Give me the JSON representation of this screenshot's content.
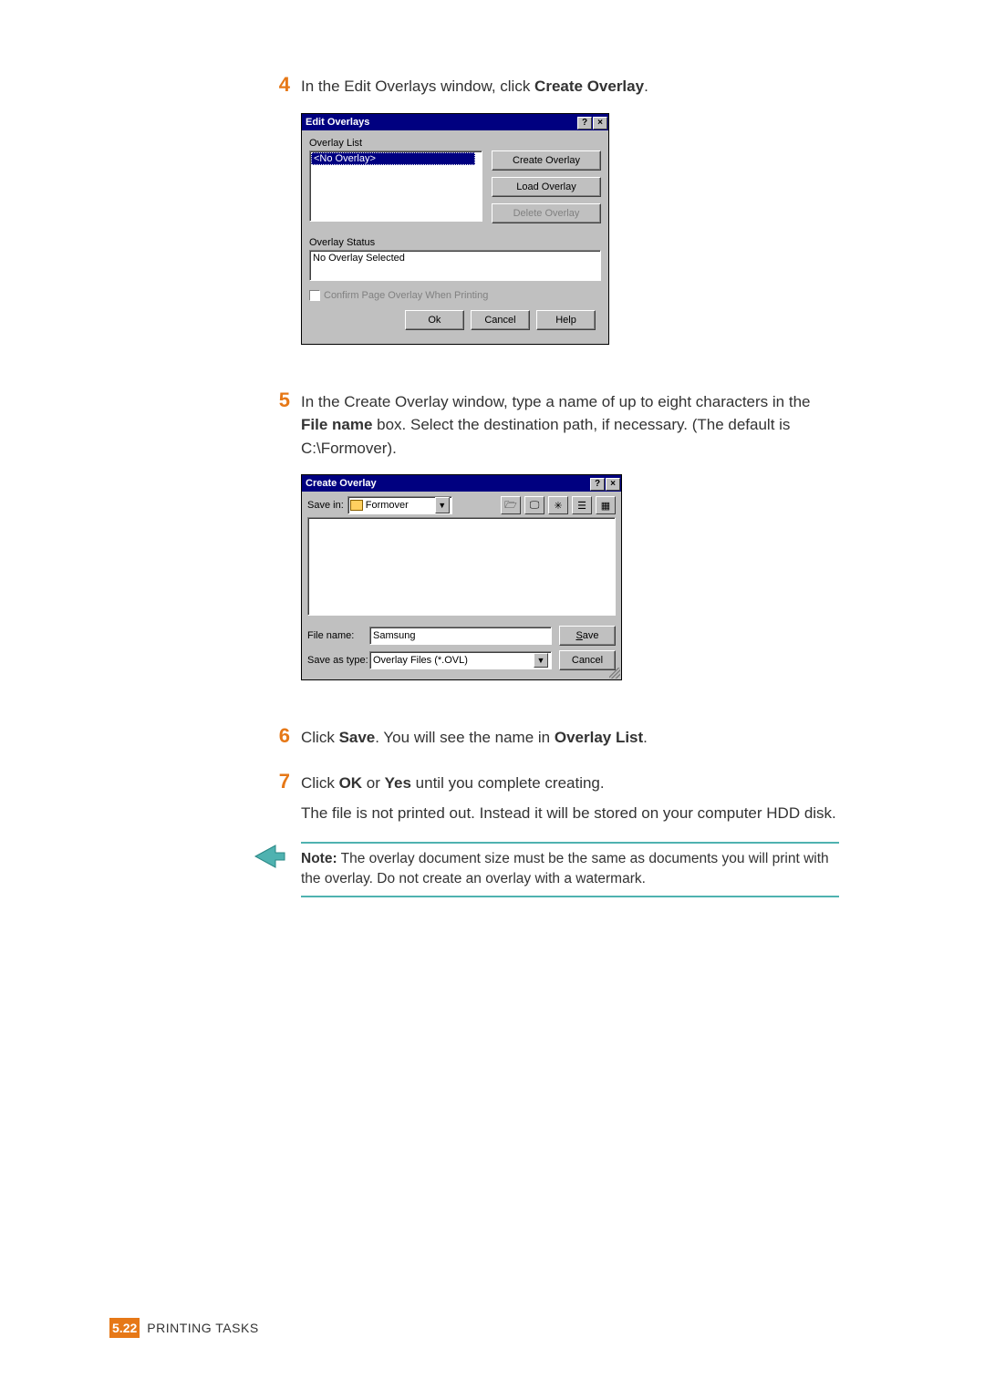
{
  "step4": {
    "num": "4",
    "text_pre": "In the Edit Overlays window, click ",
    "bold": "Create Overlay",
    "text_post": "."
  },
  "editOverlays": {
    "title": "Edit Overlays",
    "helpBtn": "?",
    "closeBtn": "×",
    "listLabel": "Overlay List",
    "listItem": "<No Overlay>",
    "btnCreate": "Create Overlay",
    "btnLoad": "Load Overlay",
    "btnDelete": "Delete Overlay",
    "statusLabel": "Overlay Status",
    "statusText": "No Overlay Selected",
    "confirmChk": "Confirm Page Overlay When Printing",
    "ok": "Ok",
    "cancel": "Cancel",
    "help": "Help"
  },
  "step5": {
    "num": "5",
    "t1": "In the Create Overlay window, type a name of up to eight characters in the ",
    "b1": "File name",
    "t2": " box. Select the destination path, if necessary. (The default is C:\\Formover)."
  },
  "createOverlay": {
    "title": "Create Overlay",
    "helpBtn": "?",
    "closeBtn": "×",
    "saveInLabel": "Save in:",
    "saveInFolder": "Formover",
    "fileNameLabel": "File name:",
    "fileNameValue": "Samsung",
    "saveAsTypeLabel": "Save as type:",
    "saveAsTypeValue": "Overlay Files (*.OVL)",
    "saveBtn": "Save",
    "cancelBtn": "Cancel"
  },
  "step6": {
    "num": "6",
    "t1": "Click ",
    "b1": "Save",
    "t2": ". You will see the name in ",
    "b2": "Overlay List",
    "t3": "."
  },
  "step7": {
    "num": "7",
    "t1": "Click ",
    "b1": "OK",
    "t2": " or ",
    "b2": "Yes",
    "t3": " until you complete creating."
  },
  "step7b": "The file is not printed out. Instead it will be stored on your computer HDD disk.",
  "note": {
    "label": "Note:",
    "text": " The overlay document size must be the same as documents you will print with the overlay. Do not create an overlay with a watermark."
  },
  "footer": {
    "chapter": "5.",
    "page": "22",
    "title": "PRINTING TASKS"
  }
}
